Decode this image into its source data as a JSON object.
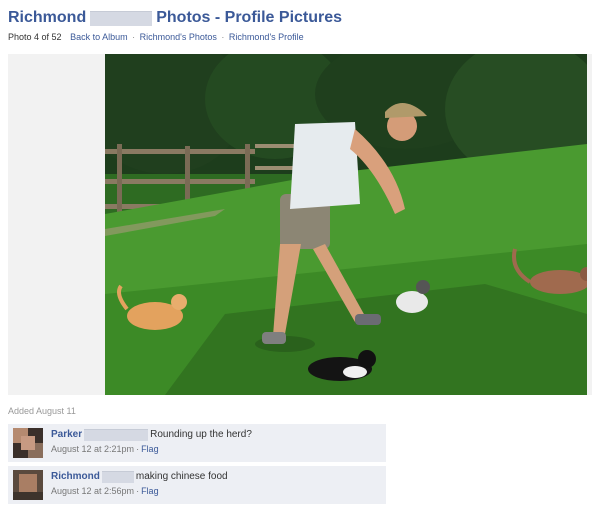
{
  "header": {
    "profile_name": "Richmond",
    "title": "Photos - Profile Pictures"
  },
  "subnav": {
    "photo_count": "Photo 4 of 52",
    "back_link": "Back to Album",
    "photos_link": "Richmond's Photos",
    "profile_link": "Richmond's Profile",
    "separator": "·"
  },
  "photo": {
    "added": "Added August 11"
  },
  "comments": [
    {
      "author": "Parker",
      "text": "Rounding up the herd?",
      "time": "August 12 at 2:21pm",
      "flag": "Flag"
    },
    {
      "author": "Richmond",
      "text": "making chinese food",
      "time": "August 12 at 2:56pm",
      "flag": "Flag"
    }
  ],
  "colors": {
    "link": "#3b5998",
    "comment_bg": "#edeff4",
    "grass": "#3c8a26",
    "trees": "#1d3d1c"
  }
}
